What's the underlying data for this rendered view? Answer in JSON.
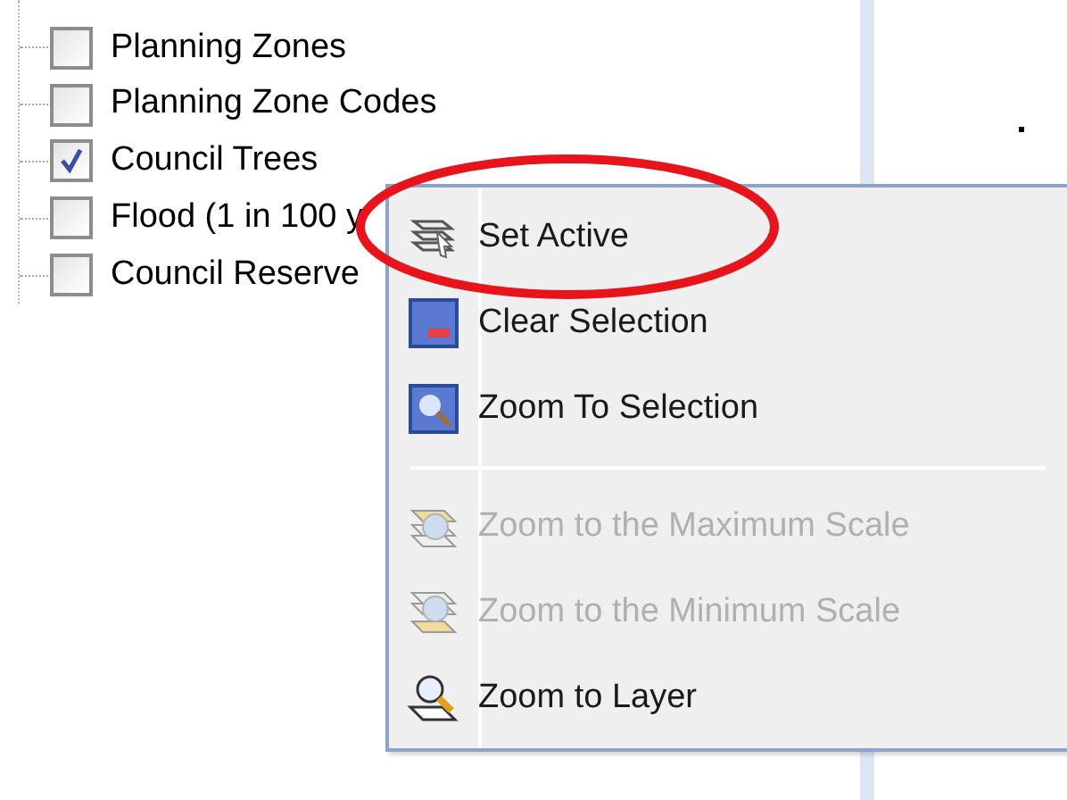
{
  "layers": [
    {
      "label": "Planning Zones",
      "checked": false
    },
    {
      "label": "Planning Zone Codes",
      "checked": false
    },
    {
      "label": "Council Trees",
      "checked": true
    },
    {
      "label": "Flood (1 in 100 y",
      "checked": false
    },
    {
      "label": "Council Reserve",
      "checked": false
    }
  ],
  "context_menu": {
    "items": [
      {
        "kind": "item",
        "label": "Set Active",
        "disabled": false,
        "circled": true
      },
      {
        "kind": "item",
        "label": "Clear Selection",
        "disabled": false,
        "circled": false
      },
      {
        "kind": "item",
        "label": "Zoom To Selection",
        "disabled": false,
        "circled": false
      },
      {
        "kind": "separator"
      },
      {
        "kind": "item",
        "label": "Zoom to the Maximum Scale",
        "disabled": true,
        "circled": false
      },
      {
        "kind": "item",
        "label": "Zoom to the Minimum Scale",
        "disabled": true,
        "circled": false
      },
      {
        "kind": "item",
        "label": "Zoom to Layer",
        "disabled": false,
        "circled": false
      }
    ]
  }
}
